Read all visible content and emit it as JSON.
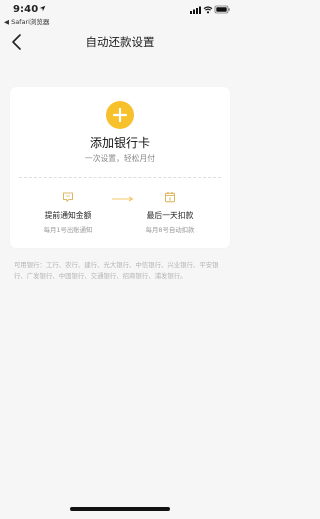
{
  "status_bar": {
    "time": "9:40",
    "back_app": "◀ Safari浏览器"
  },
  "nav": {
    "title": "自动还款设置"
  },
  "card": {
    "add_title": "添加银行卡",
    "add_subtitle": "一次设置，轻松月付",
    "steps": [
      {
        "title": "提前通知金额",
        "desc": "每月1号出账通知"
      },
      {
        "title": "最后一天扣款",
        "desc": "每月8号自动扣款"
      }
    ],
    "calendar_day": "8"
  },
  "banks_text": "可用银行：工行、农行、建行、光大银行、中信银行、兴业银行、平安银行、广发银行、中国银行、交通银行、招商银行、浦发银行。",
  "colors": {
    "accent": "#f6c12a",
    "background": "#f6f6f6",
    "card": "#ffffff",
    "muted_text": "#999999"
  }
}
